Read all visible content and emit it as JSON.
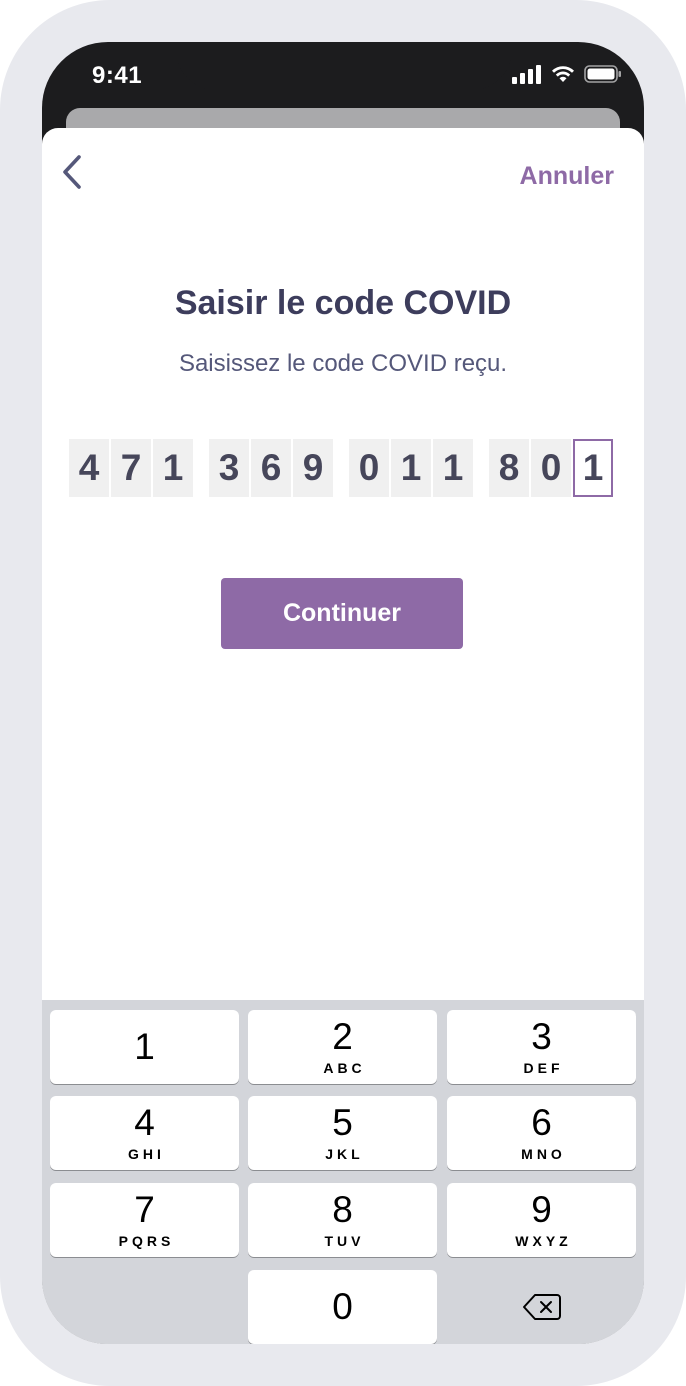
{
  "status_bar": {
    "time": "9:41"
  },
  "header": {
    "cancel_label": "Annuler"
  },
  "main": {
    "title": "Saisir le code COVID",
    "subtitle": "Saisissez le code COVID reçu.",
    "code_groups": [
      [
        "4",
        "7",
        "1"
      ],
      [
        "3",
        "6",
        "9"
      ],
      [
        "0",
        "1",
        "1"
      ],
      [
        "8",
        "0",
        "1"
      ]
    ],
    "continue_label": "Continuer"
  },
  "keyboard": {
    "keys": [
      {
        "num": "1",
        "letters": ""
      },
      {
        "num": "2",
        "letters": "ABC"
      },
      {
        "num": "3",
        "letters": "DEF"
      },
      {
        "num": "4",
        "letters": "GHI"
      },
      {
        "num": "5",
        "letters": "JKL"
      },
      {
        "num": "6",
        "letters": "MNO"
      },
      {
        "num": "7",
        "letters": "PQRS"
      },
      {
        "num": "8",
        "letters": "TUV"
      },
      {
        "num": "9",
        "letters": "WXYZ"
      },
      {
        "num": "0",
        "letters": ""
      }
    ]
  },
  "colors": {
    "accent": "#8e6aa6",
    "text_dark": "#3d3d5c",
    "keyboard_bg": "#d3d5da"
  }
}
